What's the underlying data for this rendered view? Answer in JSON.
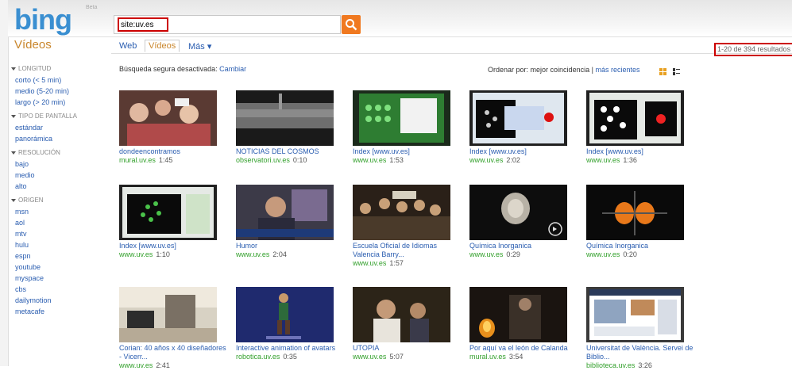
{
  "brand": {
    "logo": "bing",
    "beta": "Beta",
    "vertical": "Vídeos"
  },
  "search": {
    "query": "site:uv.es",
    "button_icon": "search-icon"
  },
  "tabs": [
    {
      "label": "Web"
    },
    {
      "label": "Vídeos"
    },
    {
      "label": "Más ▾"
    }
  ],
  "results_count": "1-20 de 394 resultados",
  "filters": {
    "longitud": {
      "title": "LONGITUD",
      "items": [
        "corto (< 5 min)",
        "medio (5-20 min)",
        "largo (> 20 min)"
      ]
    },
    "pantalla": {
      "title": "TIPO DE PANTALLA",
      "items": [
        "estándar",
        "panorámica"
      ]
    },
    "resolucion": {
      "title": "RESOLUCIÓN",
      "items": [
        "bajo",
        "medio",
        "alto"
      ]
    },
    "origen": {
      "title": "ORIGEN",
      "items": [
        "msn",
        "aol",
        "mtv",
        "hulu",
        "espn",
        "youtube",
        "myspace",
        "cbs",
        "dailymotion",
        "metacafe"
      ]
    }
  },
  "safe_search": {
    "text": "Búsqueda segura desactivada:",
    "link": "Cambiar"
  },
  "sort": {
    "label": "Ordenar por:",
    "current": "mejor coincidencia",
    "separator": "|",
    "other": "más recientes"
  },
  "videos": [
    {
      "title": "dondeencontramos",
      "source": "mural.uv.es",
      "duration": "1:45",
      "thumb": "people"
    },
    {
      "title": "NOTICIAS DEL COSMOS",
      "source": "observatori.uv.es",
      "duration": "0:10",
      "thumb": "gray"
    },
    {
      "title": "Index [www.uv.es]",
      "source": "www.uv.es",
      "duration": "1:53",
      "thumb": "green-window"
    },
    {
      "title": "Index [www.uv.es]",
      "source": "www.uv.es",
      "duration": "2:02",
      "thumb": "software-dialog"
    },
    {
      "title": "Index [www.uv.es]",
      "source": "www.uv.es",
      "duration": "1:36",
      "thumb": "software-crystal"
    },
    {
      "title": "Index [www.uv.es]",
      "source": "www.uv.es",
      "duration": "1:10",
      "thumb": "software-green"
    },
    {
      "title": "Humor",
      "source": "www.uv.es",
      "duration": "2:04",
      "thumb": "presenter"
    },
    {
      "title": "Escuela Oficial de Idiomas Valencia Barry...",
      "source": "www.uv.es",
      "duration": "1:57",
      "thumb": "crowd"
    },
    {
      "title": "Química Inorganica",
      "source": "www.uv.es",
      "duration": "0:29",
      "thumb": "dark-object"
    },
    {
      "title": "Química Inorganica",
      "source": "www.uv.es",
      "duration": "0:20",
      "thumb": "orange-orbital"
    },
    {
      "title": "Corian: 40 años x 40 diseñadores - Vicerr...",
      "source": "www.uv.es",
      "duration": "2:41",
      "thumb": "gallery"
    },
    {
      "title": "Interactive animation of avatars",
      "source": "robotica.uv.es",
      "duration": "0:35",
      "thumb": "avatar"
    },
    {
      "title": "UTOPIA",
      "source": "www.uv.es",
      "duration": "5:07",
      "thumb": "interview"
    },
    {
      "title": "Por aquí va el león de Calanda",
      "source": "mural.uv.es",
      "duration": "3:54",
      "thumb": "fire"
    },
    {
      "title": "Universitat de València. Servei de Biblio...",
      "source": "biblioteca.uv.es",
      "duration": "3:26",
      "thumb": "web-page"
    }
  ]
}
